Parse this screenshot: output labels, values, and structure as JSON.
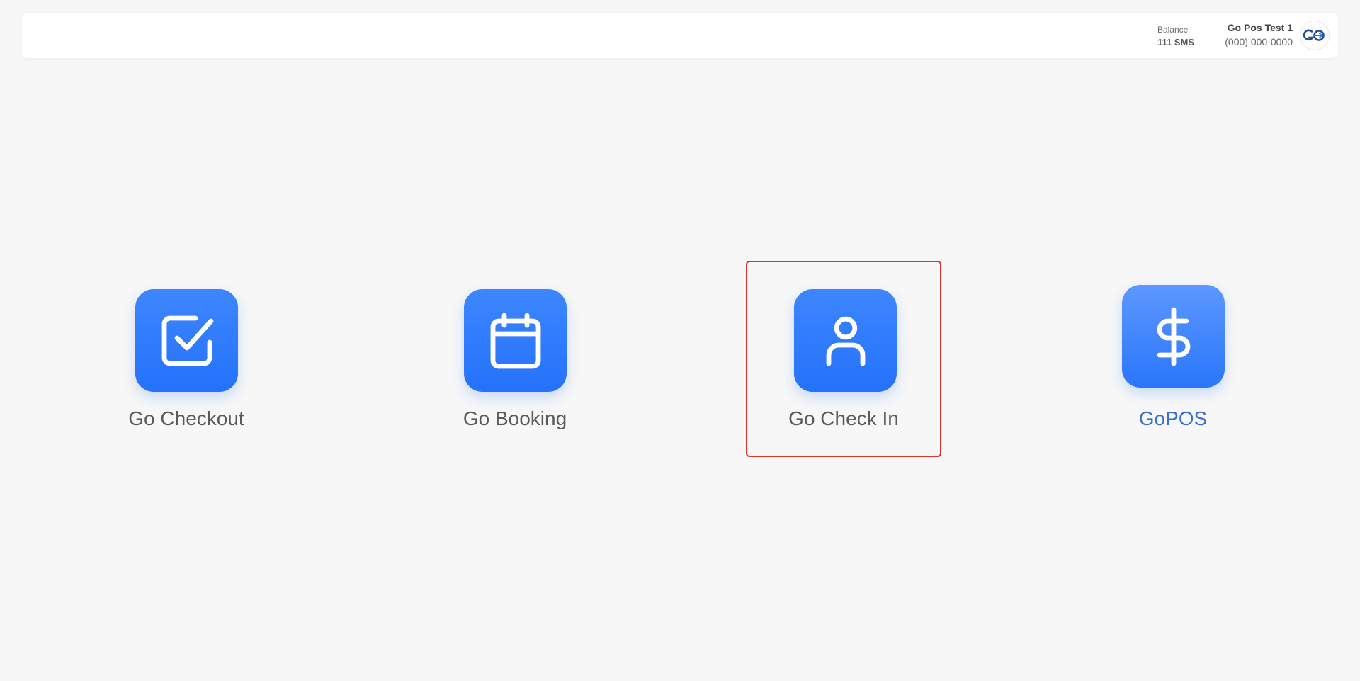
{
  "header": {
    "balance_label": "Balance",
    "balance_value": "111 SMS",
    "account_name": "Go Pos Test 1",
    "account_phone": "(000) 000-0000",
    "logo_text": "GO"
  },
  "apps": [
    {
      "label": "Go Checkout",
      "icon": "checkbox-icon"
    },
    {
      "label": "Go Booking",
      "icon": "calendar-icon"
    },
    {
      "label": "Go Check In",
      "icon": "user-icon",
      "highlighted": true
    },
    {
      "label": "GoPOS",
      "icon": "dollar-icon"
    }
  ],
  "colors": {
    "background": "#f7f7f7",
    "icon_blue": "#2f7bff",
    "highlight_red": "#e0302a",
    "gopos_label": "#3a6fd0"
  }
}
